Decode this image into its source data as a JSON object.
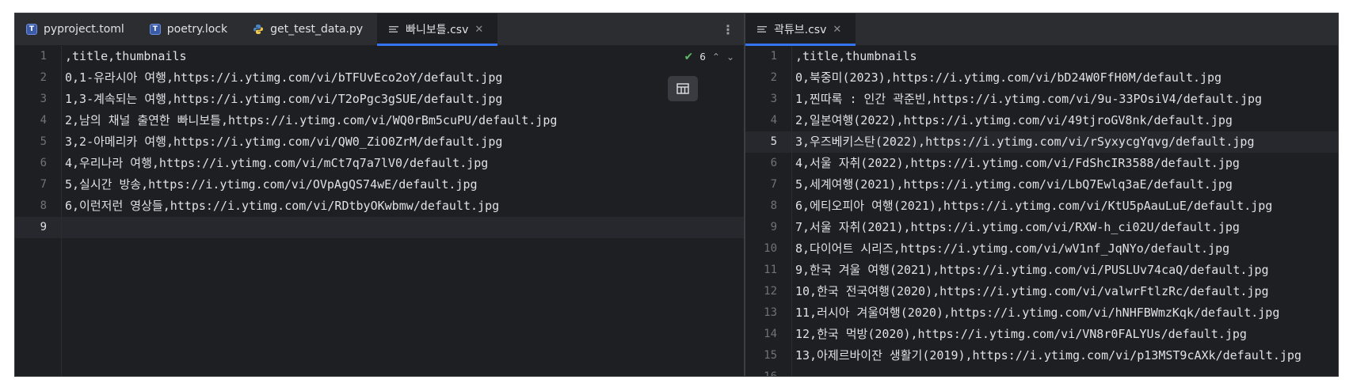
{
  "left_pane": {
    "tabs": [
      {
        "label": "pyproject.toml",
        "icon": "toml-file-icon",
        "active": false
      },
      {
        "label": "poetry.lock",
        "icon": "toml-file-icon",
        "active": false
      },
      {
        "label": "get_test_data.py",
        "icon": "python-file-icon",
        "active": false
      },
      {
        "label": "빠니보틀.csv",
        "icon": "csv-file-icon",
        "active": true
      }
    ],
    "inspection": {
      "count": "6"
    },
    "current_line": 9,
    "lines": [
      ",title,thumbnails",
      "0,1-유라시아 여행,https://i.ytimg.com/vi/bTFUvEco2oY/default.jpg",
      "1,3-계속되는 여행,https://i.ytimg.com/vi/T2oPgc3gSUE/default.jpg",
      "2,남의 채널 출연한 빠니보틀,https://i.ytimg.com/vi/WQ0rBm5cuPU/default.jpg",
      "3,2-아메리카 여행,https://i.ytimg.com/vi/QW0_ZiO0ZrM/default.jpg",
      "4,우리나라 여행,https://i.ytimg.com/vi/mCt7q7a7lV0/default.jpg",
      "5,실시간 방송,https://i.ytimg.com/vi/OVpAgQS74wE/default.jpg",
      "6,이런저런 영상들,https://i.ytimg.com/vi/RDtbyOKwbmw/default.jpg",
      ""
    ]
  },
  "right_pane": {
    "tabs": [
      {
        "label": "곽튜브.csv",
        "icon": "csv-file-icon",
        "active": true
      }
    ],
    "current_line": 5,
    "lines": [
      ",title,thumbnails",
      "0,북중미(2023),https://i.ytimg.com/vi/bD24W0FfH0M/default.jpg",
      "1,찐따록 : 인간 곽준빈,https://i.ytimg.com/vi/9u-33POsiV4/default.jpg",
      "2,일본여행(2022),https://i.ytimg.com/vi/49tjroGV8nk/default.jpg",
      "3,우즈베키스탄(2022),https://i.ytimg.com/vi/rSyxycgYqvg/default.jpg",
      "4,서울 자취(2022),https://i.ytimg.com/vi/FdShcIR3588/default.jpg",
      "5,세계여행(2021),https://i.ytimg.com/vi/LbQ7Ewlq3aE/default.jpg",
      "6,에티오피아 여행(2021),https://i.ytimg.com/vi/KtU5pAauLuE/default.jpg",
      "7,서울 자취(2021),https://i.ytimg.com/vi/RXW-h_ci02U/default.jpg",
      "8,다이어트 시리즈,https://i.ytimg.com/vi/wV1nf_JqNYo/default.jpg",
      "9,한국 겨울 여행(2021),https://i.ytimg.com/vi/PUSLUv74caQ/default.jpg",
      "10,한국 전국여행(2020),https://i.ytimg.com/vi/valwrFtlzRc/default.jpg",
      "11,러시아 겨울여행(2020),https://i.ytimg.com/vi/hNHFBWmzKqk/default.jpg",
      "12,한국 먹방(2020),https://i.ytimg.com/vi/VN8r0FALYUs/default.jpg",
      "13,아제르바이잔 생활기(2019),https://i.ytimg.com/vi/p13MST9cAXk/default.jpg",
      ""
    ]
  },
  "colors": {
    "editor_bg": "#1e1f22",
    "tabbar_bg": "#2b2d30",
    "accent": "#3574f0",
    "text": "#dfe1e5",
    "line_number": "#6f737a"
  }
}
